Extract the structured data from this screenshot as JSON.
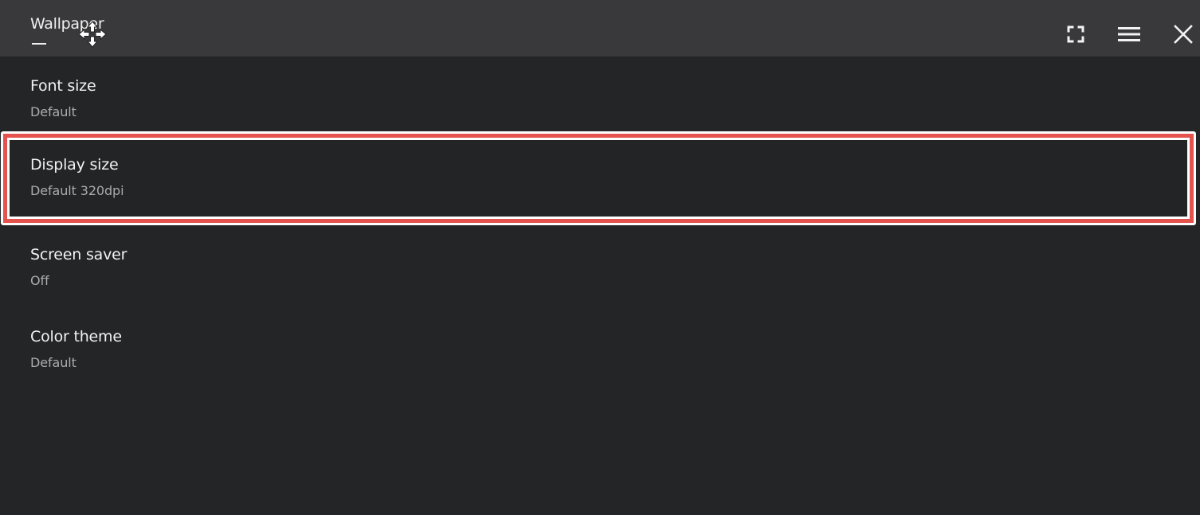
{
  "window": {
    "title": "Wallpaper",
    "icons": {
      "move": "move-arrows-icon",
      "fullscreen": "fullscreen-icon",
      "menu": "hamburger-menu-icon",
      "close": "close-icon"
    }
  },
  "settings": {
    "items": [
      {
        "label": "Font size",
        "value": "Default"
      },
      {
        "label": "Display size",
        "value": "Default 320dpi",
        "selected": true
      },
      {
        "label": "Screen saver",
        "value": "Off"
      },
      {
        "label": "Color theme",
        "value": "Default"
      }
    ]
  },
  "colors": {
    "background": "#242527",
    "titlebar": "#39393b",
    "focus_outline": "#e5534e",
    "focus_border": "#ffffff"
  }
}
